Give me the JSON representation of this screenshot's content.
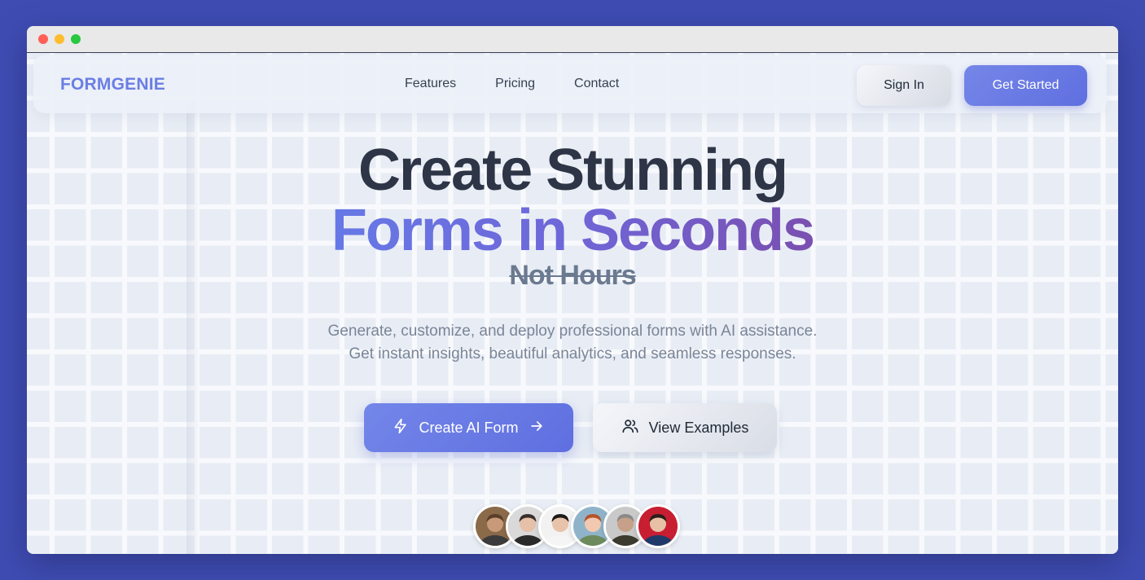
{
  "window": {
    "controls": [
      "close",
      "minimize",
      "zoom"
    ]
  },
  "navbar": {
    "brand": "FORMGENIE",
    "links": [
      "Features",
      "Pricing",
      "Contact"
    ],
    "sign_in": "Sign In",
    "get_started": "Get Started"
  },
  "hero": {
    "title_line1": "Create Stunning",
    "title_line2": "Forms in Seconds",
    "struck_text": "Not Hours",
    "subtitle_line1": "Generate, customize, and deploy professional forms with AI assistance.",
    "subtitle_line2": "Get instant insights, beautiful analytics, and seamless responses.",
    "primary_cta": "Create AI Form",
    "secondary_cta": "View Examples"
  },
  "icons": {
    "primary_cta_left": "lightning-icon",
    "primary_cta_right": "arrow-right-icon",
    "secondary_cta_left": "users-icon"
  },
  "colors": {
    "brand": "#6a7ee3",
    "accent_start": "#7386e9",
    "accent_end": "#5f6fe0",
    "gradient_purple": "#7a4fb0",
    "page_background": "#3f4db3"
  },
  "avatars": [
    {
      "name": "avatar-1",
      "bg": "#8b6a4a",
      "skin": "#c89a7a",
      "hair": "#5a3e2a",
      "shirt": "#3b3b3b"
    },
    {
      "name": "avatar-2",
      "bg": "#d9d9d9",
      "skin": "#e6c0a8",
      "hair": "#3a2e2a",
      "shirt": "#2a2a2a"
    },
    {
      "name": "avatar-3",
      "bg": "#f2f2f2",
      "skin": "#e8c3a9",
      "hair": "#1e1a18",
      "shirt": "#f5f5f5"
    },
    {
      "name": "avatar-4",
      "bg": "#8fb4c9",
      "skin": "#f0c9b0",
      "hair": "#b5542e",
      "shirt": "#6d8a5d"
    },
    {
      "name": "avatar-5",
      "bg": "#c9c9c9",
      "skin": "#c7a08a",
      "hair": "#8a8a8a",
      "shirt": "#3b3a2e"
    },
    {
      "name": "avatar-6",
      "bg": "#c81e32",
      "skin": "#e8c0a5",
      "hair": "#2a1e18",
      "shirt": "#1f3a6a"
    }
  ]
}
